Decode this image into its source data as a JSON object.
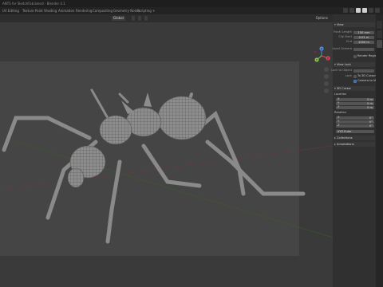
{
  "window": {
    "title": "ANTS for SketchFab.blend - Blender 4.1"
  },
  "workspaces": [
    {
      "label": "UV Editing"
    },
    {
      "label": "Texture Paint"
    },
    {
      "label": "Shading"
    },
    {
      "label": "Animation"
    },
    {
      "label": "Rendering"
    },
    {
      "label": "Compositing"
    },
    {
      "label": "Geometry Nodes"
    },
    {
      "label": "Scripting"
    },
    {
      "label": "+"
    }
  ],
  "viewport_header": {
    "pivot_label": "Global",
    "options_label": "Options"
  },
  "gizmo": {
    "x_label": "X",
    "y_label": "Y",
    "z_label": "Z"
  },
  "npanel": {
    "tabs": [
      "Item",
      "Tool",
      "View"
    ],
    "view_section": "View",
    "focal_length_label": "Focal Length",
    "focal_length_value": "150 mm",
    "clip_start_label": "Clip Start",
    "clip_start_value": "0.01 m",
    "clip_end_label": "End",
    "clip_end_value": "1000 m",
    "local_camera_label": "Local Camera",
    "local_camera_value": "",
    "render_region_label": "Render Region",
    "view_lock_section": "View Lock",
    "lock_to_object_label": "Lock to Object",
    "lock_label": "Lock",
    "to_3d_cursor_label": "To 3D Cursor",
    "camera_to_view_label": "Camera to View",
    "cursor_section": "3D Cursor",
    "location_label": "Location",
    "loc_x_label": "X",
    "loc_x_value": "0 m",
    "loc_y_label": "Y",
    "loc_y_value": "0 m",
    "loc_z_label": "Z",
    "loc_z_value": "0 m",
    "rotation_label": "Rotation",
    "rot_x_label": "X",
    "rot_x_value": "0°",
    "rot_y_label": "Y",
    "rot_y_value": "0°",
    "rot_z_label": "Z",
    "rot_z_value": "0°",
    "rotation_mode_value": "XYZ Euler",
    "collections_section": "Collections",
    "annotations_section": "Annotations"
  },
  "colors": {
    "accent": "#4772b3",
    "axis_x": "#e0465a",
    "axis_y": "#8bc34a",
    "axis_z": "#4f8fe6"
  }
}
